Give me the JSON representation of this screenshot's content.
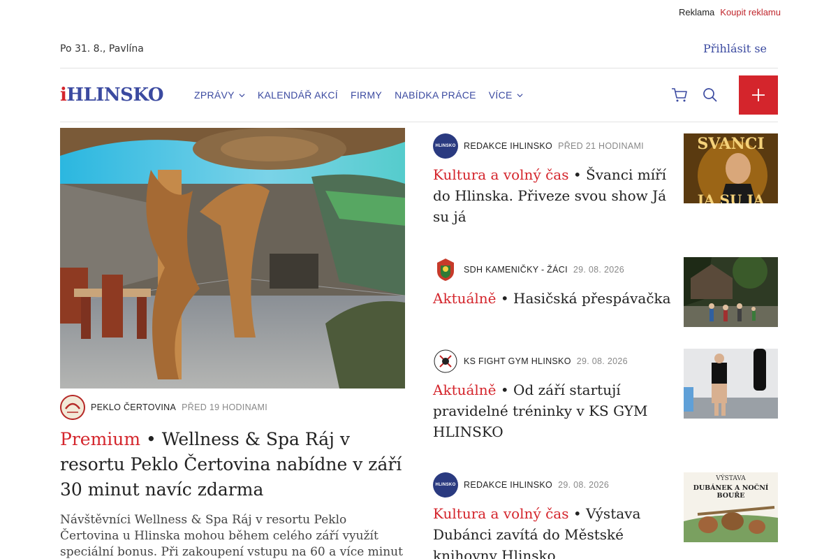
{
  "topbar": {
    "ad_label": "Reklama",
    "buy_ad_label": "Koupit reklamu"
  },
  "header": {
    "date_nameday": "Po 31. 8., Pavlína",
    "login_label": "Přihlásit se"
  },
  "logo": {
    "prefix": "i",
    "name": "HLINSKO"
  },
  "nav": {
    "items": [
      {
        "label": "ZPRÁVY",
        "has_dropdown": true
      },
      {
        "label": "KALENDÁŘ AKCÍ",
        "has_dropdown": false
      },
      {
        "label": "FIRMY",
        "has_dropdown": false
      },
      {
        "label": "NABÍDKA PRÁCE",
        "has_dropdown": false
      },
      {
        "label": "VÍCE",
        "has_dropdown": true
      }
    ],
    "icons": [
      "cart-icon",
      "search-icon",
      "plus-icon"
    ]
  },
  "main_article": {
    "author": "PEKLO ČERTOVINA",
    "time": "PŘED 19 HODINAMI",
    "category": "Premium",
    "separator": " • ",
    "title": "Wellness & Spa Ráj v resortu Peklo Čertovina nabídne v září 30 minut navíc zdarma",
    "perex": "Návštěvníci Wellness & Spa Ráj v resortu Peklo Čertovina u Hlinska mohou během celého září využít speciální bonus. Při zakoupení vstupu na 60 a více minut a platbě přímo…"
  },
  "side_articles": [
    {
      "author": "REDAKCE IHLINSKO",
      "time": "PŘED 21 HODINAMI",
      "category": "Kultura a volný čas",
      "separator": " • ",
      "title": "Švanci míří do Hlinska. Přiveze svou show Já su já",
      "avatar_text": "HLINSKO",
      "thumb_text": "SVANCI",
      "thumb_text2": "JÁ SU JÁ"
    },
    {
      "author": "SDH KAMENIČKY - ŽÁCI",
      "time": "29. 08. 2026",
      "category": "Aktuálně",
      "separator": " • ",
      "title": "Hasičská přespávačka",
      "avatar_text": "",
      "thumb_text": "",
      "thumb_text2": ""
    },
    {
      "author": "KS FIGHT GYM HLINSKO",
      "time": "29. 08. 2026",
      "category": "Aktuálně",
      "separator": " • ",
      "title": "Od září startují pravidelné tréninky v KS GYM HLINSKO",
      "avatar_text": "",
      "thumb_text": "",
      "thumb_text2": ""
    },
    {
      "author": "REDAKCE IHLINSKO",
      "time": "29. 08. 2026",
      "category": "Kultura a volný čas",
      "separator": " • ",
      "title": "Výstava Dubánci zavítá do Městské knihovny Hlinsko",
      "avatar_text": "HLINSKO",
      "thumb_text": "VÝSTAVA",
      "thumb_text2": "DUBÁNEK A NOČNÍ BOUŘE"
    }
  ],
  "colors": {
    "brand_blue": "#3b4aa0",
    "brand_red": "#d4252c"
  }
}
